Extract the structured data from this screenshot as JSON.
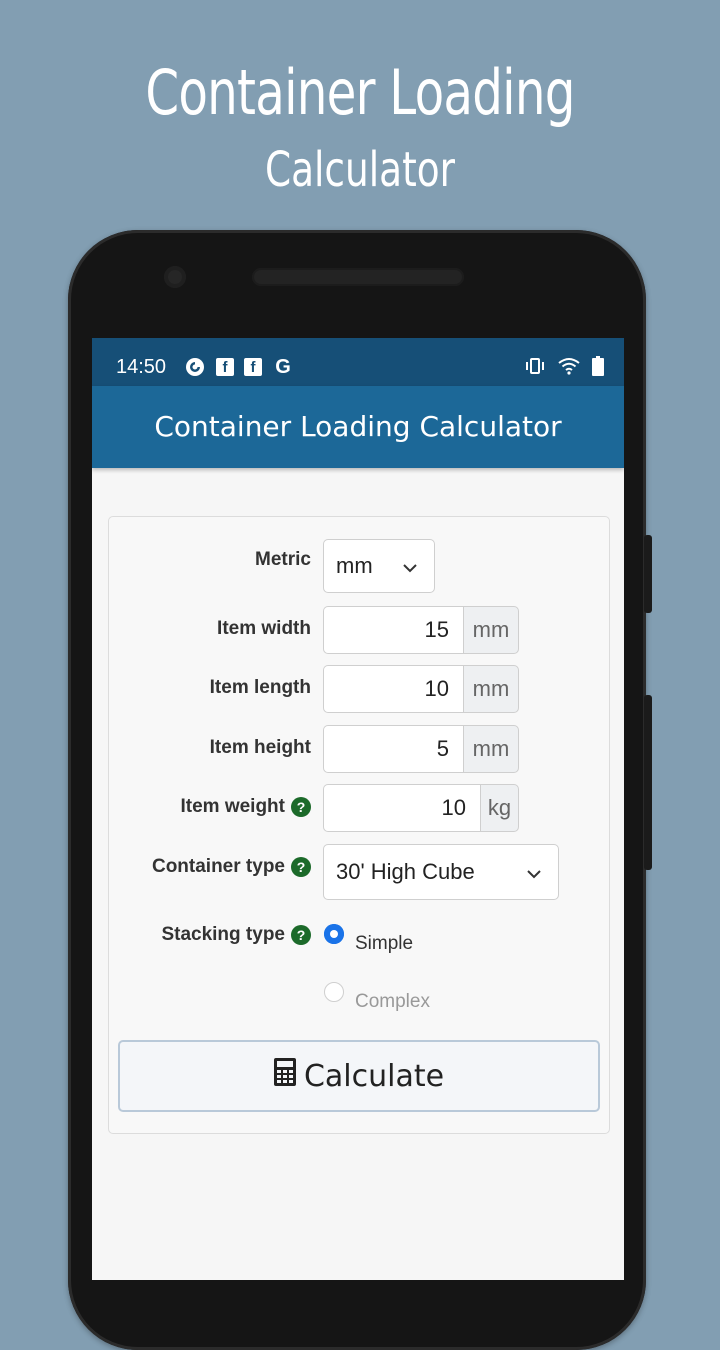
{
  "promo": {
    "title_line1": "Container Loading",
    "title_line2": "Calculator"
  },
  "status_bar": {
    "time": "14:50",
    "left_icons": [
      "pocket-casts-icon",
      "facebook-icon",
      "facebook-icon",
      "google-icon"
    ],
    "right_icons": [
      "vibrate-icon",
      "wifi-icon",
      "battery-icon"
    ]
  },
  "app_bar": {
    "title": "Container Loading Calculator"
  },
  "form": {
    "metric": {
      "label": "Metric",
      "value": "mm"
    },
    "item_width": {
      "label": "Item width",
      "value": "15",
      "unit": "mm"
    },
    "item_length": {
      "label": "Item length",
      "value": "10",
      "unit": "mm"
    },
    "item_height": {
      "label": "Item height",
      "value": "5",
      "unit": "mm"
    },
    "item_weight": {
      "label": "Item weight",
      "value": "10",
      "unit": "kg"
    },
    "container_type": {
      "label": "Container type",
      "value": "30' High Cube"
    },
    "stacking_type": {
      "label": "Stacking type",
      "options": [
        {
          "label": "Simple",
          "selected": true
        },
        {
          "label": "Complex",
          "selected": false
        }
      ]
    },
    "calculate_label": "Calculate"
  },
  "colors": {
    "background": "#829eb2",
    "status_bar": "#164f77",
    "app_bar": "#1c6898",
    "help_badge": "#1c6a2a",
    "radio_accent": "#1a73e8"
  }
}
